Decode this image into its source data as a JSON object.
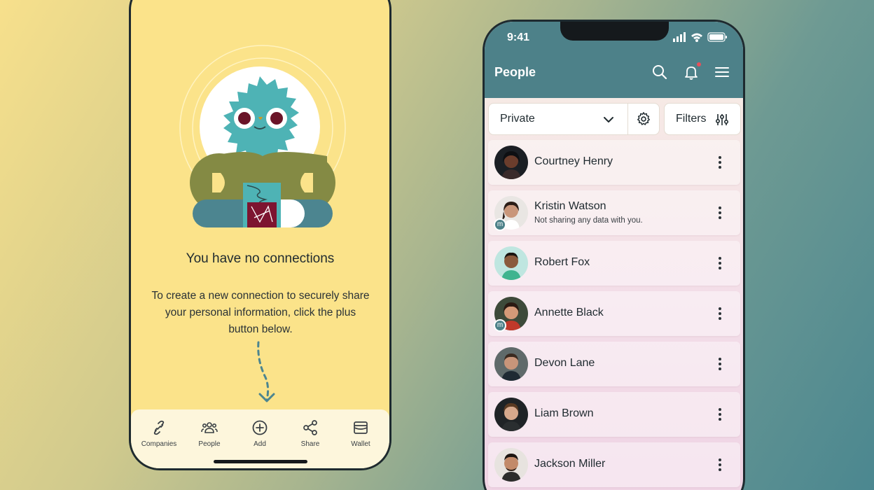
{
  "left_phone": {
    "empty_title": "You have no connections",
    "empty_description": "To create a new connection to securely share your personal information,  click the plus button below.",
    "nav": [
      {
        "label": "Companies",
        "icon": "link-icon"
      },
      {
        "label": "People",
        "icon": "people-icon"
      },
      {
        "label": "Add",
        "icon": "plus-circle-icon"
      },
      {
        "label": "Share",
        "icon": "share-icon"
      },
      {
        "label": "Wallet",
        "icon": "wallet-icon"
      }
    ]
  },
  "right_phone": {
    "status_time": "9:41",
    "title": "People",
    "select_value": "Private",
    "filters_label": "Filters",
    "accent_color": "#4d8189",
    "people": [
      {
        "name": "Courtney Henry",
        "sub": "",
        "badge": ""
      },
      {
        "name": "Kristin Watson",
        "sub": "Not sharing any data with you.",
        "badge": "m"
      },
      {
        "name": "Robert Fox",
        "sub": "",
        "badge": ""
      },
      {
        "name": "Annette Black",
        "sub": "",
        "badge": "m"
      },
      {
        "name": "Devon Lane",
        "sub": "",
        "badge": ""
      },
      {
        "name": "Liam Brown",
        "sub": "",
        "badge": ""
      },
      {
        "name": "Jackson Miller",
        "sub": "",
        "badge": ""
      }
    ]
  }
}
